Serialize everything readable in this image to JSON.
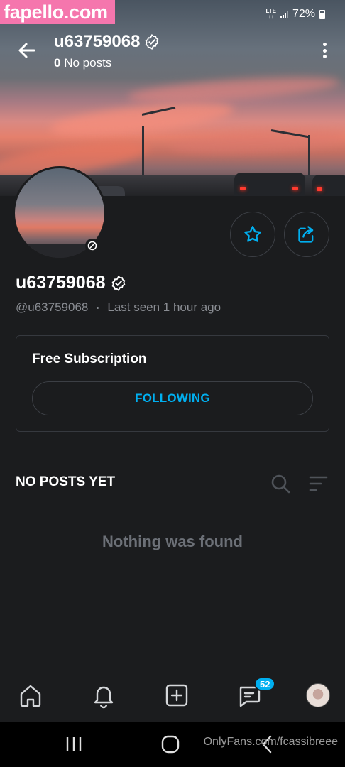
{
  "watermark_site": "fapello.com",
  "status_bar": {
    "network": "LTE",
    "battery": "72%"
  },
  "header": {
    "username": "u63759068",
    "post_count": "0",
    "post_count_label": "No posts"
  },
  "profile": {
    "display_name": "u63759068",
    "handle": "@u63759068",
    "last_seen": "Last seen 1 hour ago"
  },
  "subscription": {
    "title": "Free Subscription",
    "button_label": "FOLLOWING"
  },
  "posts": {
    "heading": "NO POSTS YET",
    "empty_message": "Nothing was found"
  },
  "bottom_nav": {
    "items": [
      "home-icon",
      "notifications-icon",
      "add-post-icon",
      "messages-icon",
      "profile-avatar"
    ],
    "messages_badge": "52"
  },
  "footer_watermark": "OnlyFans.com/fcassibreee",
  "colors": {
    "accent": "#00aff0",
    "background": "#1b1c1e",
    "brand_pink": "#f576ad"
  }
}
